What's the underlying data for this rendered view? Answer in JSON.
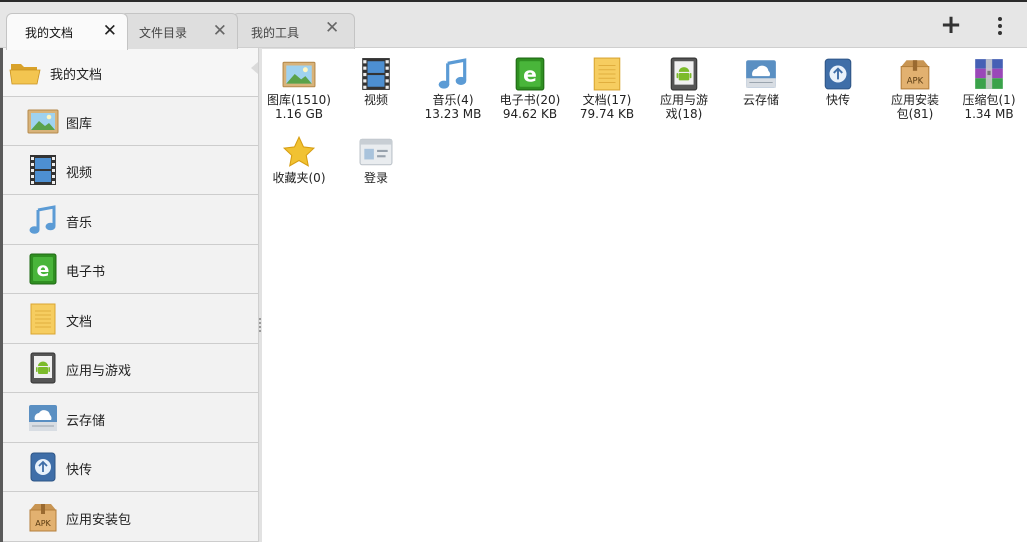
{
  "tabs": [
    {
      "label": "我的文档",
      "active": true
    },
    {
      "label": "文件目录",
      "active": false
    },
    {
      "label": "我的工具",
      "active": false
    }
  ],
  "toolbar": {
    "add": "+",
    "add_icon": "plus-icon",
    "menu_icon": "overflow-menu-icon"
  },
  "sidebar": {
    "header": {
      "label": "我的文档",
      "icon": "folder-icon"
    },
    "items": [
      {
        "label": "图库",
        "icon": "picture-icon"
      },
      {
        "label": "视频",
        "icon": "film-icon"
      },
      {
        "label": "音乐",
        "icon": "music-note-icon"
      },
      {
        "label": "电子书",
        "icon": "ebook-icon"
      },
      {
        "label": "文档",
        "icon": "document-icon"
      },
      {
        "label": "应用与游戏",
        "icon": "android-icon"
      },
      {
        "label": "云存储",
        "icon": "cloud-icon"
      },
      {
        "label": "快传",
        "icon": "transfer-icon"
      },
      {
        "label": "应用安装包",
        "icon": "apk-box-icon"
      }
    ]
  },
  "grid": [
    {
      "name": "图库(1510)",
      "size": "1.16 GB",
      "icon": "picture-icon"
    },
    {
      "name": "视频",
      "size": "",
      "icon": "film-icon"
    },
    {
      "name": "音乐(4)",
      "size": "13.23 MB",
      "icon": "music-note-icon"
    },
    {
      "name": "电子书(20)",
      "size": "94.62 KB",
      "icon": "ebook-icon"
    },
    {
      "name": "文档(17)",
      "size": "79.74 KB",
      "icon": "document-icon"
    },
    {
      "name": "应用与游",
      "size": "戏(18)",
      "icon": "android-icon"
    },
    {
      "name": "云存储",
      "size": "",
      "icon": "cloud-icon"
    },
    {
      "name": "快传",
      "size": "",
      "icon": "transfer-icon"
    },
    {
      "name": "应用安装",
      "size": "包(81)",
      "icon": "apk-box-icon"
    },
    {
      "name": "压缩包(1)",
      "size": "1.34 MB",
      "icon": "archive-icon"
    },
    {
      "name": "收藏夹(0)",
      "size": "",
      "icon": "star-icon"
    },
    {
      "name": "登录",
      "size": "",
      "icon": "login-card-icon"
    }
  ],
  "colors": {
    "tabbar_bg": "#e6e6e6",
    "sidebar_bg": "#f2f2f2",
    "content_bg": "#ffffff",
    "ebook_green": "#3a9a2a",
    "folder_yellow": "#f2c34a"
  }
}
